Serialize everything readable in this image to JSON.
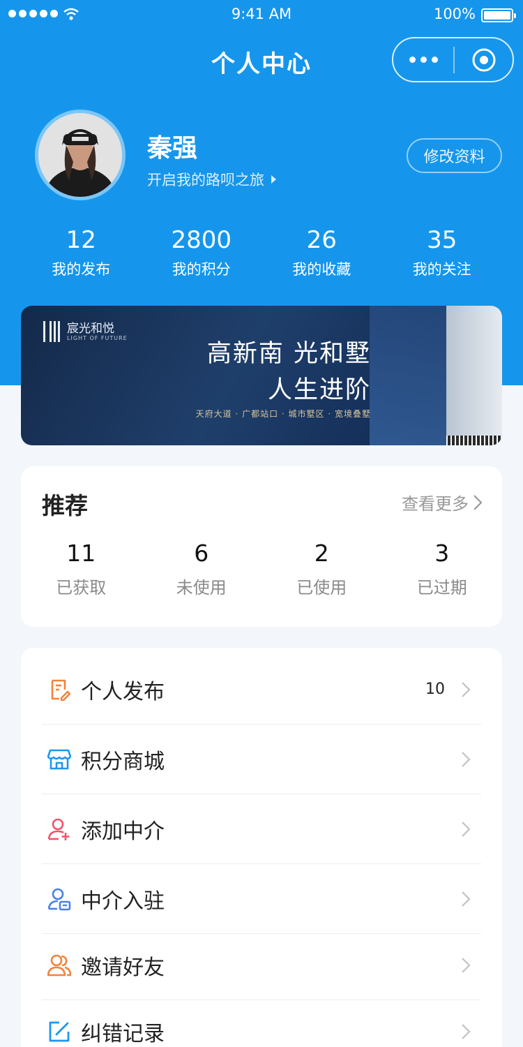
{
  "status_bar": {
    "time": "9:41 AM",
    "battery": "100%"
  },
  "navbar": {
    "title": "个人中心"
  },
  "profile": {
    "name": "秦强",
    "slogan": "开启我的路呗之旅",
    "edit_label": "修改资料"
  },
  "stats": [
    {
      "num": "12",
      "label": "我的发布"
    },
    {
      "num": "2800",
      "label": "我的积分"
    },
    {
      "num": "26",
      "label": "我的收藏"
    },
    {
      "num": "35",
      "label": "我的关注"
    }
  ],
  "banner": {
    "logo_name": "宸光和悦",
    "logo_en": "LIGHT OF FUTURE",
    "headline_1": "高新南 光和墅",
    "headline_2": "人生进阶",
    "subline": "天府大道 · 广都站口 · 城市墅区 · 宽境叠墅"
  },
  "recommend": {
    "title": "推荐",
    "more_label": "查看更多",
    "items": [
      {
        "num": "11",
        "label": "已获取"
      },
      {
        "num": "6",
        "label": "未使用"
      },
      {
        "num": "2",
        "label": "已使用"
      },
      {
        "num": "3",
        "label": "已过期"
      }
    ]
  },
  "menu": [
    {
      "label": "个人发布",
      "count": "10",
      "icon": "edit-document-icon",
      "color": "#f0833a"
    },
    {
      "label": "积分商城",
      "count": "",
      "icon": "store-icon",
      "color": "#1e96ee"
    },
    {
      "label": "添加中介",
      "count": "",
      "icon": "add-user-icon",
      "color": "#f0536b"
    },
    {
      "label": "中介入驻",
      "count": "",
      "icon": "agent-icon",
      "color": "#4a7fe6"
    },
    {
      "label": "邀请好友",
      "count": "",
      "icon": "friends-icon",
      "color": "#f0833a"
    },
    {
      "label": "纠错记录",
      "count": "",
      "icon": "correction-icon",
      "color": "#1e96ee"
    }
  ],
  "colors": {
    "primary": "#1596ec",
    "background": "#f3f6fa"
  }
}
